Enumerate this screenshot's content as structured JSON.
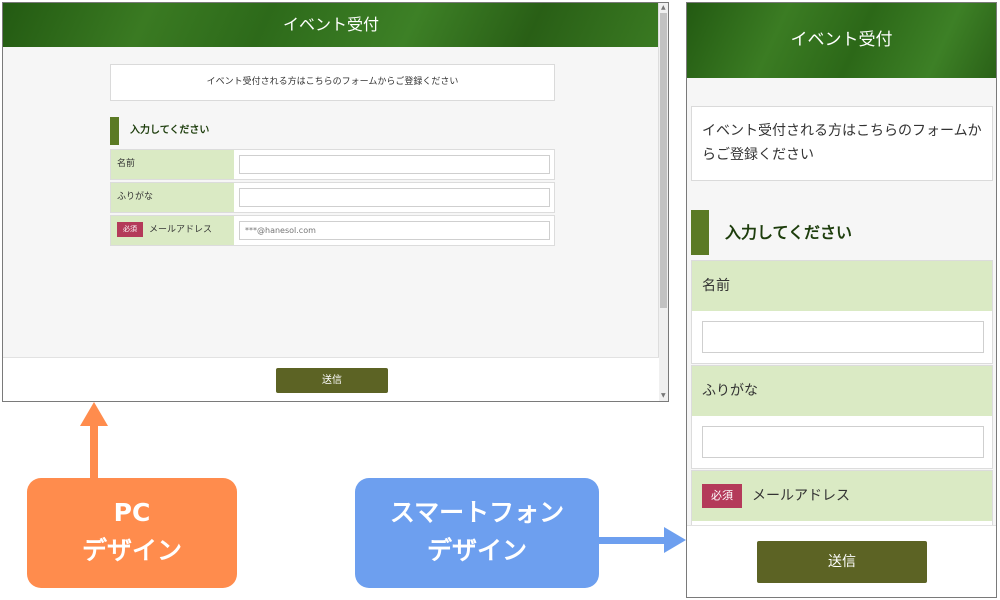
{
  "pc": {
    "title": "イベント受付",
    "intro": "イベント受付される方はこちらのフォームからご登録ください",
    "section_heading": "入力してください",
    "fields": [
      {
        "label": "名前",
        "value": "",
        "placeholder": ""
      },
      {
        "label": "ふりがな",
        "value": "",
        "placeholder": ""
      },
      {
        "label": "メールアドレス",
        "required_badge": "必須",
        "value": "",
        "placeholder": "***@hanesol.com"
      }
    ],
    "submit_label": "送信"
  },
  "smartphone": {
    "title": "イベント受付",
    "intro": "イベント受付される方はこちらのフォームからご登録ください",
    "section_heading": "入力してください",
    "fields": [
      {
        "label": "名前",
        "value": ""
      },
      {
        "label": "ふりがな",
        "value": ""
      },
      {
        "label": "メールアドレス",
        "required_badge": "必須"
      }
    ],
    "submit_label": "送信"
  },
  "callouts": {
    "pc": {
      "line1": "PC",
      "line2": "デザイン",
      "color": "#ff8c4d"
    },
    "smartphone": {
      "line1": "スマートフォン",
      "line2": "デザイン",
      "color": "#6d9fef"
    }
  },
  "colors": {
    "header_green": "#2d6a1a",
    "label_bg": "#daeac4",
    "accent_bar": "#5b7a24",
    "submit_button": "#5c6324",
    "required_badge": "#b43a5a"
  }
}
